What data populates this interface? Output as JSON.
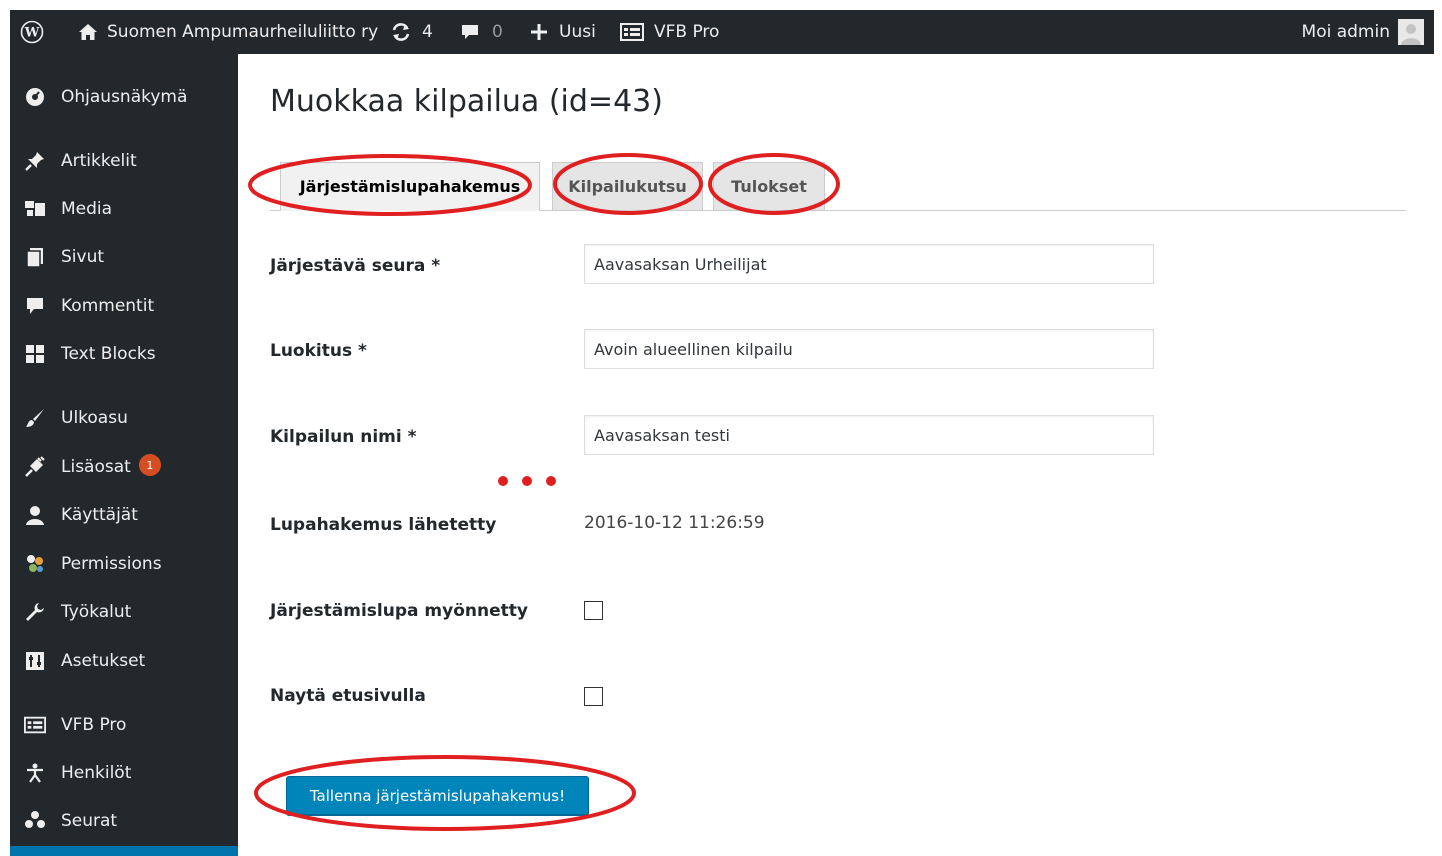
{
  "adminbar": {
    "site_name": "Suomen Ampumaurheiluliitto ry",
    "updates_count": "4",
    "comments_count": "0",
    "new_label": "Uusi",
    "vfb_label": "VFB Pro",
    "greeting": "Moi admin"
  },
  "sidebar": {
    "items": [
      {
        "label": "Ohjausnäkymä",
        "icon": "dashboard-icon"
      },
      {
        "label": "Artikkelit",
        "icon": "pin-icon"
      },
      {
        "label": "Media",
        "icon": "media-icon"
      },
      {
        "label": "Sivut",
        "icon": "pages-icon"
      },
      {
        "label": "Kommentit",
        "icon": "comment-icon"
      },
      {
        "label": "Text Blocks",
        "icon": "grid-icon"
      },
      {
        "label": "Ulkoasu",
        "icon": "brush-icon"
      },
      {
        "label": "Lisäosat",
        "icon": "plugin-icon",
        "badge": "1"
      },
      {
        "label": "Käyttäjät",
        "icon": "user-icon"
      },
      {
        "label": "Permissions",
        "icon": "permissions-icon"
      },
      {
        "label": "Työkalut",
        "icon": "wrench-icon"
      },
      {
        "label": "Asetukset",
        "icon": "settings-icon"
      },
      {
        "label": "VFB Pro",
        "icon": "form-icon"
      },
      {
        "label": "Henkilöt",
        "icon": "person-icon"
      },
      {
        "label": "Seurat",
        "icon": "groups-icon"
      }
    ]
  },
  "page": {
    "title": "Muokkaa kilpailua (id=43)"
  },
  "tabs": [
    {
      "label": "Järjestämislupahakemus",
      "active": true
    },
    {
      "label": "Kilpailukutsu",
      "active": false
    },
    {
      "label": "Tulokset",
      "active": false
    }
  ],
  "form": {
    "organizer_label": "Järjestävä seura *",
    "organizer_value": "Aavasaksan Urheilijat",
    "class_label": "Luokitus *",
    "class_value": "Avoin alueellinen kilpailu",
    "name_label": "Kilpailun nimi *",
    "name_value": "Aavasaksan testi",
    "sent_label": "Lupahakemus lähetetty",
    "sent_value": "2016-10-12 11:26:59",
    "granted_label": "Järjestämislupa myönnetty",
    "granted_checked": false,
    "frontpage_label": "Naytä etusivulla",
    "frontpage_checked": false,
    "save_label": "Tallenna järjestämislupahakemus!"
  },
  "colors": {
    "adminbar_bg": "#23282d",
    "primary_button": "#0085ba",
    "annotation": "#e02020",
    "badge": "#d54e21"
  }
}
